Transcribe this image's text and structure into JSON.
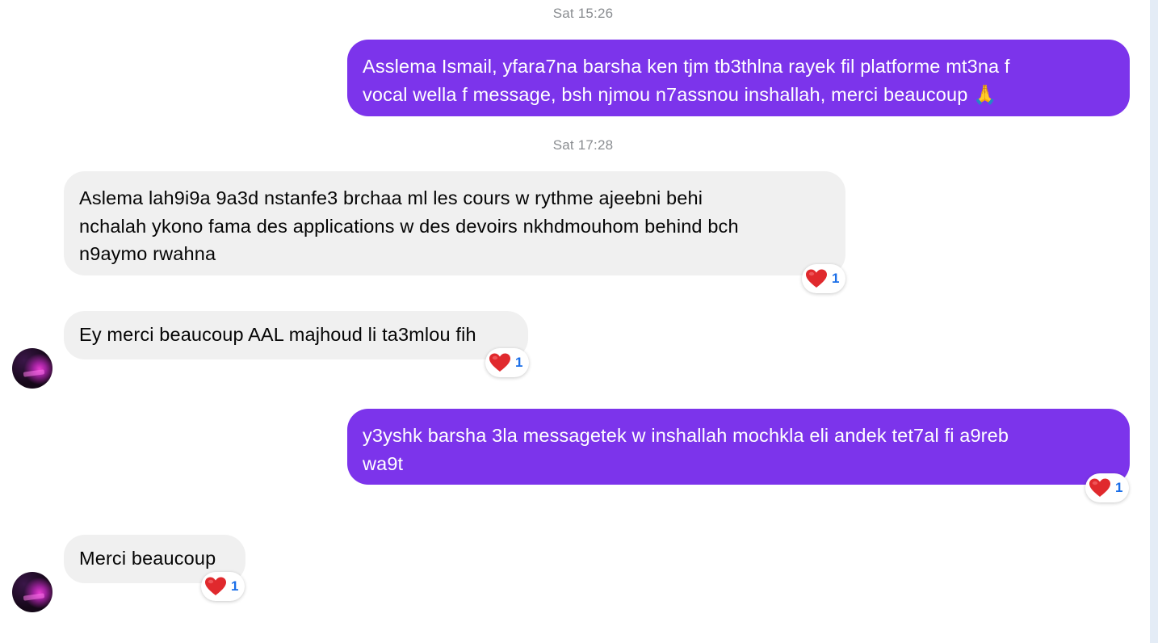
{
  "timestamps": [
    "Sat 15:26",
    "Sat 17:28"
  ],
  "messages": [
    {
      "direction": "outgoing",
      "lines": [
        "Asslema Ismail, yfara7na barsha ken tjm tb3thlna rayek fil platforme mt3na f",
        "vocal wella f message, bsh njmou n7assnou inshallah, merci beaucoup 🙏"
      ]
    },
    {
      "direction": "incoming",
      "lines": [
        "Aslema lah9i9a 9a3d nstanfe3 brchaa ml les cours w rythme ajeebni behi",
        "nchalah ykono fama des applications w des devoirs nkhdmouhom behind bch",
        "n9aymo rwahna"
      ],
      "reaction": {
        "emoji": "heart",
        "count": "1"
      }
    },
    {
      "direction": "incoming",
      "lines": [
        "Ey merci beaucoup AAL majhoud li ta3mlou fih"
      ],
      "reaction": {
        "emoji": "heart",
        "count": "1"
      }
    },
    {
      "direction": "outgoing",
      "lines": [
        "y3yshk barsha 3la messagetek w inshallah mochkla eli andek tet7al fi a9reb",
        "wa9t"
      ],
      "reaction": {
        "emoji": "heart",
        "count": "1"
      }
    },
    {
      "direction": "incoming",
      "lines": [
        "Merci beaucoup"
      ],
      "reaction": {
        "emoji": "heart",
        "count": "1"
      }
    }
  ],
  "colors": {
    "outgoing_bubble": "#7c34eb",
    "incoming_bubble": "#f0f0f0",
    "timestamp_text": "#8a8d91",
    "reaction_count": "#1a6ee8",
    "heart": "#e0292d"
  }
}
